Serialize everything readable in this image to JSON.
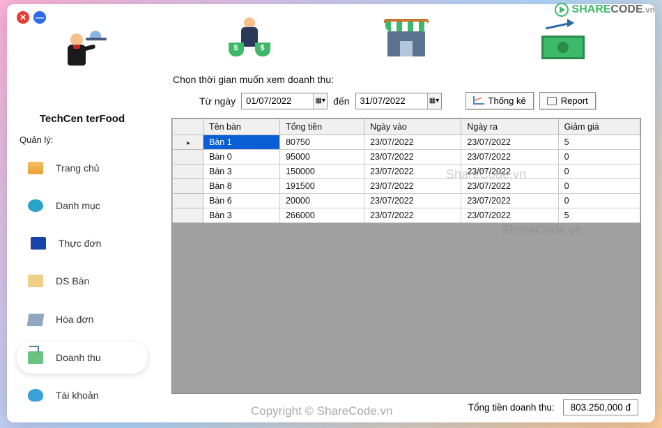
{
  "brand": "TechCen    terFood",
  "section_label": "Quản lý:",
  "nav": [
    {
      "label": "Trang chủ"
    },
    {
      "label": "Danh mục"
    },
    {
      "label": "Thực đơn"
    },
    {
      "label": "DS Bàn"
    },
    {
      "label": "Hóa đơn"
    },
    {
      "label": "Doanh thu"
    },
    {
      "label": "Tài khoản"
    }
  ],
  "prompt": "Chọn thời gian muốn xem doanh thu:",
  "from_label": "Từ ngày",
  "to_label": "đến",
  "from_date": "01/07/2022",
  "to_date": "31/07/2022",
  "btn_stats": "Thống kê",
  "btn_report": "Report",
  "columns": {
    "c0": "Tên bàn",
    "c1": "Tổng tiền",
    "c2": "Ngày vào",
    "c3": "Ngày ra",
    "c4": "Giảm giá"
  },
  "rows": [
    {
      "name": "Bàn 1",
      "total": "80750",
      "in": "23/07/2022",
      "out": "23/07/2022",
      "disc": "5"
    },
    {
      "name": "Bàn 0",
      "total": "95000",
      "in": "23/07/2022",
      "out": "23/07/2022",
      "disc": "0"
    },
    {
      "name": "Bàn 3",
      "total": "150000",
      "in": "23/07/2022",
      "out": "23/07/2022",
      "disc": "0"
    },
    {
      "name": "Bàn 8",
      "total": "191500",
      "in": "23/07/2022",
      "out": "23/07/2022",
      "disc": "0"
    },
    {
      "name": "Bàn 6",
      "total": "20000",
      "in": "23/07/2022",
      "out": "23/07/2022",
      "disc": "0"
    },
    {
      "name": "Bàn 3",
      "total": "266000",
      "in": "23/07/2022",
      "out": "23/07/2022",
      "disc": "5"
    }
  ],
  "total_label": "Tổng tiền doanh thu:",
  "total_value": "803.250,000 đ",
  "watermark": "ShareCode.vn",
  "copyright": "Copyright © ShareCode.vn",
  "logo": {
    "t1": "SHARE",
    "t2": "CODE",
    "t3": ".vn"
  }
}
